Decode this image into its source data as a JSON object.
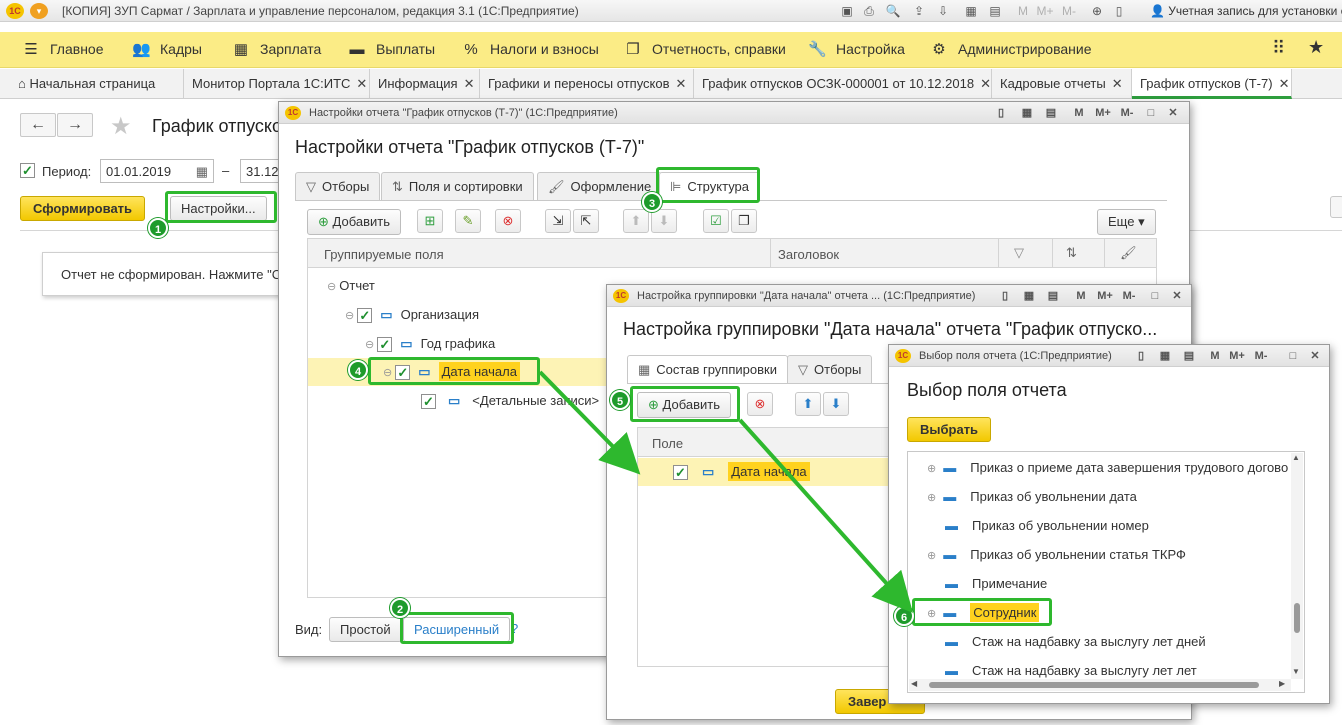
{
  "titlebar": {
    "logo": "1С",
    "title": "[КОПИЯ] ЗУП Сармат / Зарплата и управление персоналом, редакция 3.1  (1С:Предприятие)",
    "account": "Учетная запись для установки об..."
  },
  "sections": [
    {
      "icon": "hamburger-icon",
      "glyph": "☰",
      "label": "Главное"
    },
    {
      "icon": "people-icon",
      "glyph": "👥",
      "label": "Кадры"
    },
    {
      "icon": "calculator-icon",
      "glyph": "▦",
      "label": "Зарплата"
    },
    {
      "icon": "wallet-icon",
      "glyph": "▬",
      "label": "Выплаты"
    },
    {
      "icon": "percent-icon",
      "glyph": "%",
      "label": "Налоги и взносы"
    },
    {
      "icon": "report-icon",
      "glyph": "❐",
      "label": "Отчетность, справки"
    },
    {
      "icon": "wrench-icon",
      "glyph": "🔧",
      "label": "Настройка"
    },
    {
      "icon": "gear-icon",
      "glyph": "⚙",
      "label": "Администрирование"
    }
  ],
  "tabs": [
    {
      "label": "Начальная страница",
      "closable": false
    },
    {
      "label": "Монитор Портала 1С:ИТС",
      "closable": true
    },
    {
      "label": "Информация",
      "closable": true
    },
    {
      "label": "Графики и переносы отпусков",
      "closable": true
    },
    {
      "label": "График отпусков ОСЗК-000001 от 10.12.2018",
      "closable": true
    },
    {
      "label": "Кадровые отчеты",
      "closable": true
    },
    {
      "label": "График отпусков (Т-7)",
      "closable": true
    }
  ],
  "main": {
    "title": "График отпуско",
    "period_label": "Период:",
    "period_from": "01.01.2019",
    "period_dash": "–",
    "period_to": "31.12",
    "generate_label": "Сформировать",
    "settings_label": "Настройки...",
    "notice": "Отчет не сформирован. Нажмите \"С"
  },
  "win1": {
    "caption": "Настройки отчета \"График отпусков (Т-7)\"  (1С:Предприятие)",
    "heading": "Настройки отчета \"График отпусков (Т-7)\"",
    "tabs": [
      {
        "icon": "filter-icon",
        "glyph": "▽",
        "label": "Отборы"
      },
      {
        "icon": "sort-icon",
        "glyph": "⇅",
        "label": "Поля и сортировки"
      },
      {
        "icon": "brush-icon",
        "glyph": "🖌",
        "label": "Оформление"
      },
      {
        "icon": "structure-icon",
        "glyph": "⊫",
        "label": "Структура"
      }
    ],
    "add_label": "Добавить",
    "more_label": "Еще",
    "col_fields": "Группируемые поля",
    "col_header": "Заголовок",
    "tree": [
      {
        "label": "Отчет"
      },
      {
        "label": "Организация"
      },
      {
        "label": "Год графика"
      },
      {
        "label": "Дата начала"
      },
      {
        "label": "<Детальные записи>"
      }
    ],
    "view_label": "Вид:",
    "view_simple": "Простой",
    "view_advanced": "Расширенный"
  },
  "win2": {
    "caption": "Настройка группировки \"Дата начала\" отчета ...  (1С:Предприятие)",
    "heading": "Настройка группировки \"Дата начала\" отчета \"График отпуско...",
    "tab_composition": "Состав группировки",
    "tab_filters": "Отборы",
    "add_label": "Добавить",
    "col_field": "Поле",
    "row_field": "Дата начала",
    "bottom_button": "Завер"
  },
  "win3": {
    "caption": "Выбор поля отчета  (1С:Предприятие)",
    "heading": "Выбор поля отчета",
    "select_label": "Выбрать",
    "items": [
      {
        "label": "Приказ о приеме дата завершения трудового догово",
        "expandable": true
      },
      {
        "label": "Приказ об увольнении дата",
        "expandable": true
      },
      {
        "label": "Приказ об увольнении номер",
        "expandable": false
      },
      {
        "label": "Приказ об увольнении статья ТКРФ",
        "expandable": true
      },
      {
        "label": "Примечание",
        "expandable": false
      },
      {
        "label": "Сотрудник",
        "expandable": true
      },
      {
        "label": "Стаж на надбавку за выслугу лет дней",
        "expandable": false
      },
      {
        "label": "Стаж на надбавку за выслугу лет лет",
        "expandable": false
      }
    ]
  },
  "callouts": [
    "1",
    "2",
    "3",
    "4",
    "5",
    "6"
  ],
  "colors": {
    "section_bar": "#fbec86",
    "accent_yellow": "#f2c800",
    "callout_green": "#2eb82e",
    "active_tab": "#2e9e3e"
  }
}
